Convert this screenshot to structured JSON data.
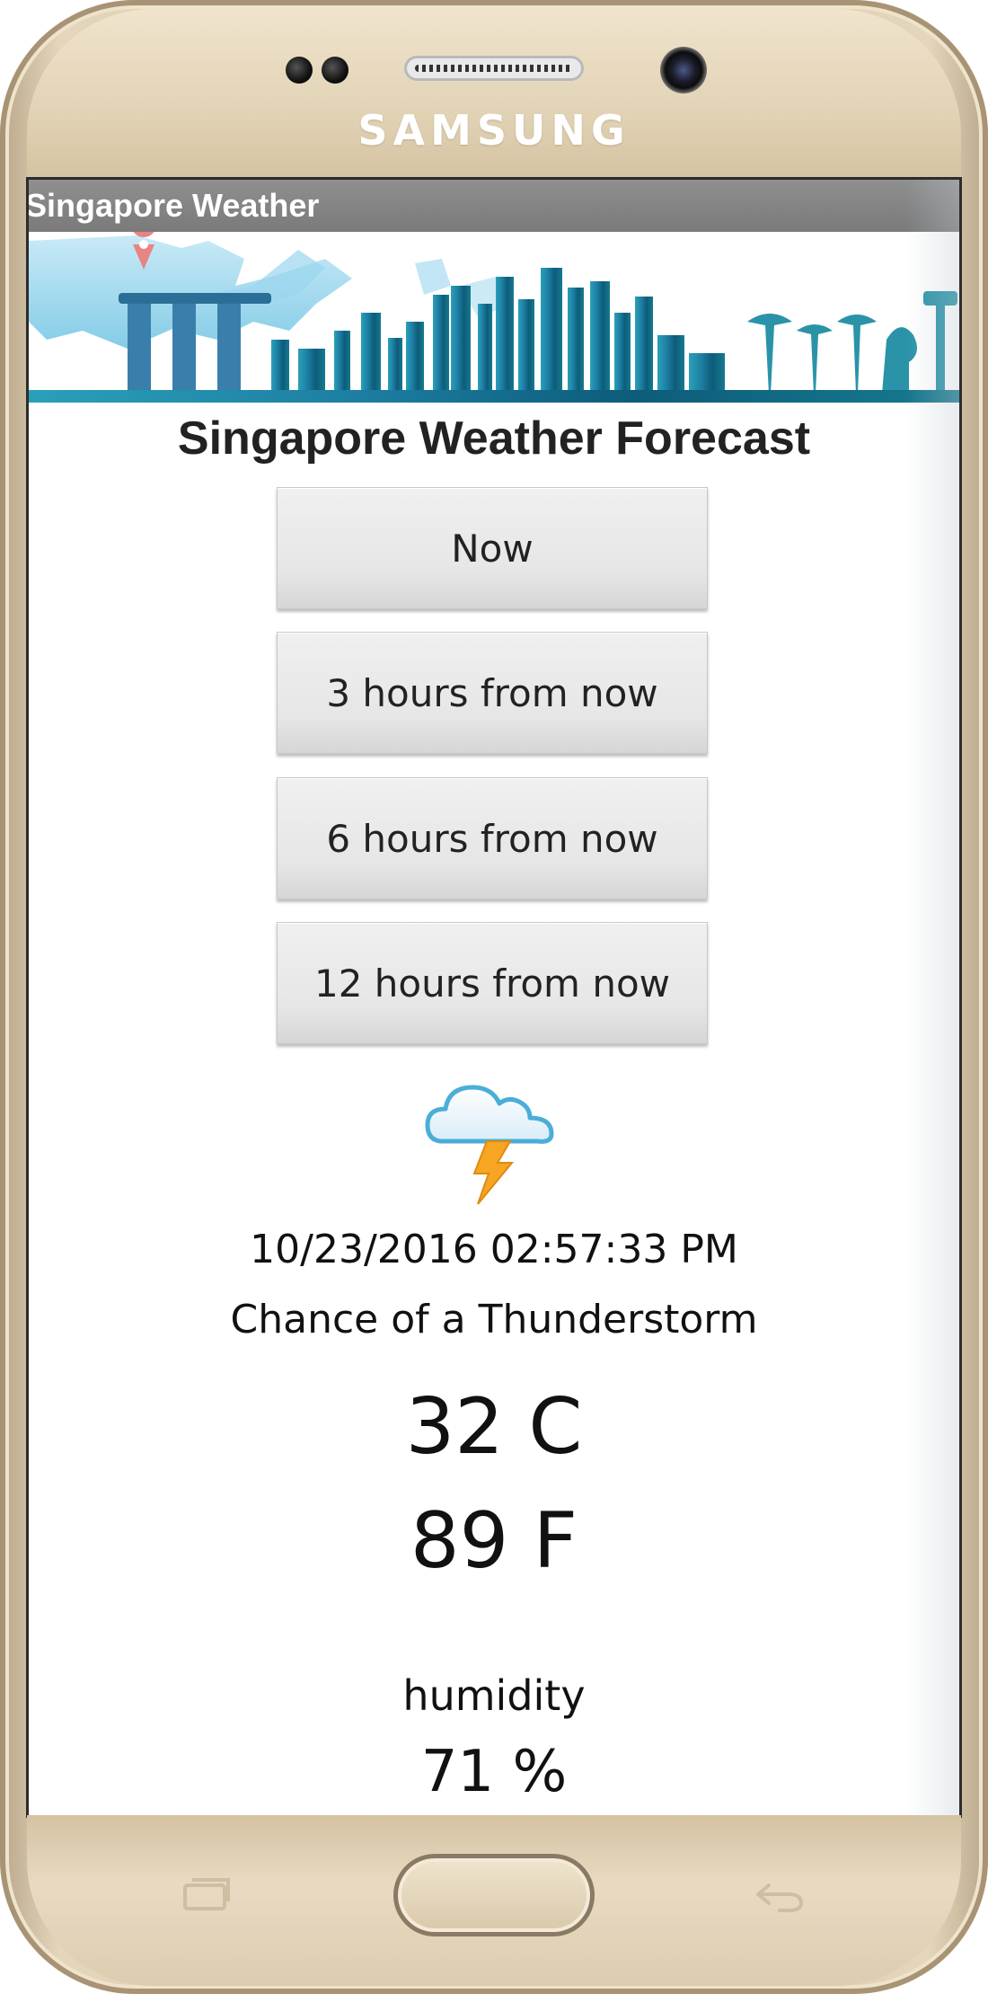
{
  "device": {
    "brand": "SAMSUNG"
  },
  "app": {
    "title": "Singapore Weather"
  },
  "page": {
    "heading": "Singapore Weather Forecast"
  },
  "buttons": [
    {
      "label": "Now"
    },
    {
      "label": "3 hours from now"
    },
    {
      "label": "6 hours from now"
    },
    {
      "label": "12 hours from now"
    }
  ],
  "forecast": {
    "icon": "thunderstorm-icon",
    "datetime": "10/23/2016 02:57:33 PM",
    "condition": "Chance of a Thunderstorm",
    "temp_c": "32  C",
    "temp_f": "89  F",
    "humidity_label": "humidity",
    "humidity_value": "71 %"
  },
  "colors": {
    "titlebar": "#7f7f7f",
    "skyline_dark": "#0d5c7a",
    "skyline_light": "#8fd0ea",
    "lightning": "#f6a623"
  }
}
